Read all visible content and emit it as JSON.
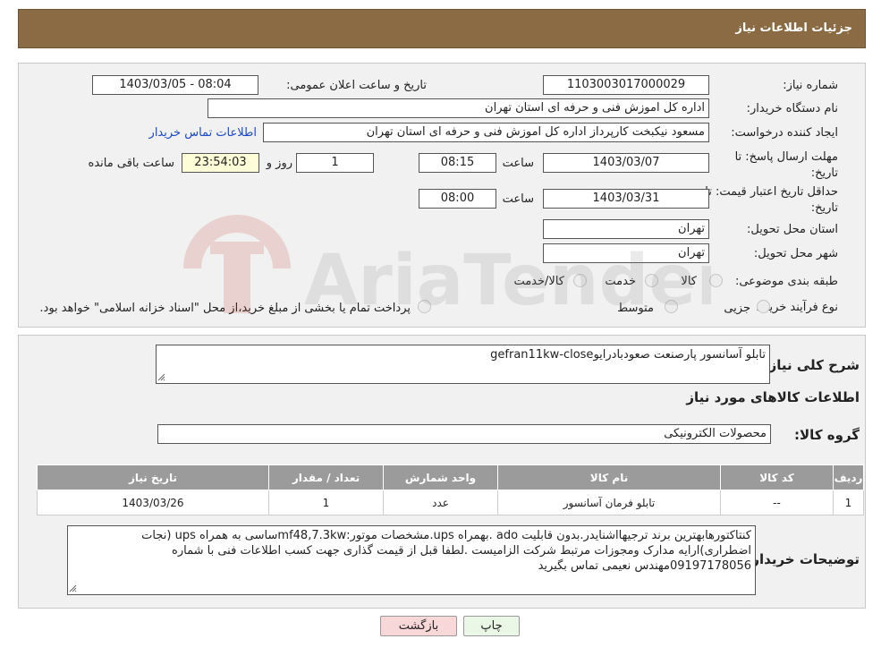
{
  "header": {
    "title": "جزئیات اطلاعات نیاز"
  },
  "form": {
    "need_number_label": "شماره نیاز:",
    "need_number": "1103003017000029",
    "announce_label": "تاریخ و ساعت اعلان عمومی:",
    "announce_value": "1403/03/05 - 08:04",
    "buyer_label": "نام دستگاه خریدار:",
    "buyer_value": "اداره کل اموزش فنی و حرفه ای استان تهران",
    "creator_label": "ایجاد کننده درخواست:",
    "creator_value": "مسعود نیکبخت کارپرداز اداره کل اموزش فنی و حرفه ای استان تهران",
    "contact_link": "اطلاعات تماس خریدار",
    "deadline_label": "مهلت ارسال پاسخ: تا تاریخ:",
    "deadline_date": "1403/03/07",
    "time_label": "ساعت",
    "deadline_time": "08:15",
    "days_value": "1",
    "days_label": "روز و",
    "remaining_value": "23:54:03",
    "remaining_label": "ساعت باقی مانده",
    "price_validity_label": "حداقل تاریخ اعتبار قیمت: تا تاریخ:",
    "price_validity_date": "1403/03/31",
    "price_validity_time": "08:00",
    "province_label": "استان محل تحویل:",
    "province_value": "تهران",
    "city_label": "شهر محل تحویل:",
    "city_value": "تهران",
    "category_label": "طبقه بندی موضوعی:",
    "category_options": [
      "کالا",
      "خدمت",
      "کالا/خدمت"
    ],
    "process_label": "نوع فرآیند خرید :",
    "process_options": [
      "جزیی",
      "متوسط"
    ],
    "process_note": "پرداخت تمام یا بخشی از مبلغ خرید،از محل \"اسناد خزانه اسلامی\" خواهد بود."
  },
  "details": {
    "summary_label": "شرح کلی نیاز:",
    "summary_value": "تابلو آسانسور پارصنعت صعودبادرایوgefran11kw-close",
    "goods_title": "اطلاعات کالاهای مورد نیاز",
    "group_label": "گروه کالا:",
    "group_value": "محصولات الکترونیکی",
    "table": {
      "headers": [
        "ردیف",
        "کد کالا",
        "نام کالا",
        "واحد شمارش",
        "تعداد / مقدار",
        "تاریخ نیاز"
      ],
      "rows": [
        [
          "1",
          "--",
          "تابلو فرمان آسانسور",
          "عدد",
          "1",
          "1403/03/26"
        ]
      ]
    },
    "buyer_notes_label": "توضیحات خریدار:",
    "buyer_notes": "کنتاکتورهابهترین برند ترجیهااشنایدر.بدون قابلیت ado .بهمراه ups.مشخصات موتور:mf48,7.3kwساسی به همراه ups (نجات اضطراری)ارایه مدارک ومجوزات مرتبط شرکت الزامیست .لطفا قبل از قیمت گذاری جهت کسب اطلاعات فنی با شماره 09197178056مهندس نعیمی تماس بگیرید"
  },
  "buttons": {
    "print": "چاپ",
    "back": "بازگشت"
  },
  "watermark": {
    "text": "AriaTender.neT"
  },
  "colors": {
    "header_bg": "#8b6b43",
    "link": "#1a48c8",
    "table_header": "#9b9b9b",
    "back_button": "#f7d7d7"
  }
}
